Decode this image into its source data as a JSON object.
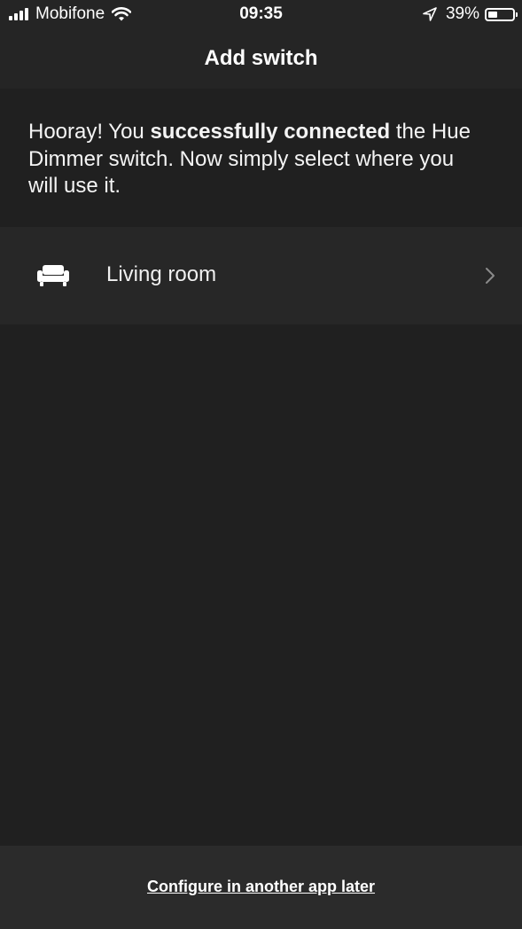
{
  "status_bar": {
    "carrier": "Mobifone",
    "time": "09:35",
    "battery_percent": "39%",
    "battery_level": 0.39,
    "icons": [
      "signal-bars-icon",
      "wifi-icon",
      "location-arrow-icon",
      "battery-icon"
    ]
  },
  "nav": {
    "title": "Add switch"
  },
  "message": {
    "part1": "Hooray! You ",
    "bold": "successfully connected",
    "part2": " the Hue Dimmer switch. Now simply select where you will use it."
  },
  "rooms": [
    {
      "label": "Living room",
      "icon": "sofa-icon"
    }
  ],
  "footer": {
    "link_label": "Configure in another app later"
  },
  "colors": {
    "background": "#202020",
    "bar": "#252525",
    "row": "#272727",
    "footer": "#2b2b2b",
    "text": "#ffffff"
  }
}
